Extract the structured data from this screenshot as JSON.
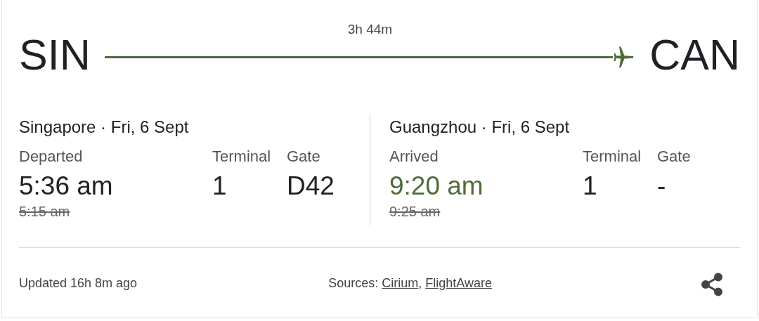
{
  "route": {
    "origin": "SIN",
    "destination": "CAN",
    "duration": "3h 44m"
  },
  "legs": [
    {
      "place": "Singapore · Fri, 6 Sept",
      "status": "Departed",
      "time": "5:36 am",
      "early": false,
      "scheduled": "5:15 am",
      "terminal_label": "Terminal",
      "terminal": "1",
      "gate_label": "Gate",
      "gate": "D42"
    },
    {
      "place": "Guangzhou · Fri, 6 Sept",
      "status": "Arrived",
      "time": "9:20 am",
      "early": true,
      "scheduled": "9:25 am",
      "terminal_label": "Terminal",
      "terminal": "1",
      "gate_label": "Gate",
      "gate": "-"
    }
  ],
  "footer": {
    "updated": "Updated 16h 8m ago",
    "sources_label": "Sources:",
    "separator": ",",
    "sources": [
      "Cirium",
      "FlightAware"
    ]
  }
}
